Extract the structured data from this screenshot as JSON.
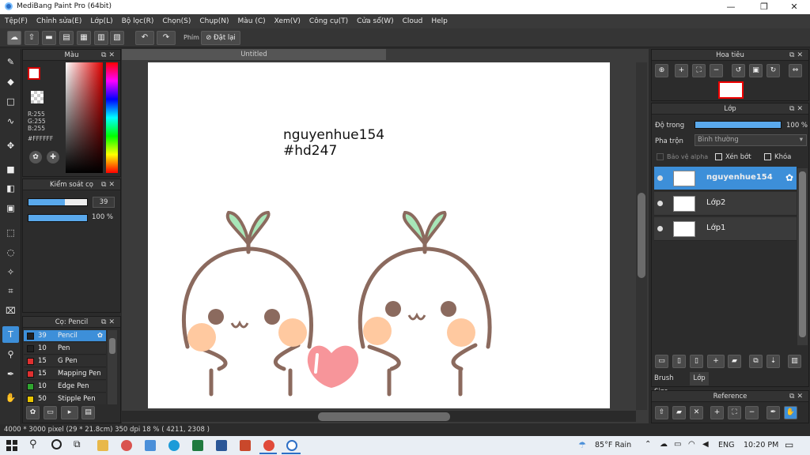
{
  "window": {
    "title": "MediBang Paint Pro (64bit)",
    "min": "—",
    "max": "❐",
    "close": "✕"
  },
  "menu": [
    "Tệp(F)",
    "Chỉnh sửa(E)",
    "Lớp(L)",
    "Bộ lọc(R)",
    "Chọn(S)",
    "Chụp(N)",
    "Màu (C)",
    "Xem(V)",
    "Công cụ(T)",
    "Cửa sổ(W)",
    "Cloud",
    "Help"
  ],
  "toolbar": {
    "key_label": "Phím",
    "reset_label": "Đặt lại"
  },
  "color_panel": {
    "title": "Màu",
    "r": "R:255",
    "g": "G:255",
    "b": "B:255",
    "hex": "#FFFFFF",
    "primary": "#ffffff",
    "secondary": "#d40000"
  },
  "brush_control": {
    "title": "Kiểm soát cọ",
    "size": "39",
    "opacity": "100 %",
    "size_fraction": 0.62,
    "opacity_fraction": 1.0
  },
  "brush_panel": {
    "title": "Cọ: Pencil",
    "items": [
      {
        "size": "39",
        "name": "Pencil",
        "color": "#222222",
        "selected": true
      },
      {
        "size": "10",
        "name": "Pen",
        "color": "#222222",
        "selected": false
      },
      {
        "size": "15",
        "name": "G Pen",
        "color": "#e03030",
        "selected": false
      },
      {
        "size": "15",
        "name": "Mapping Pen",
        "color": "#e03030",
        "selected": false
      },
      {
        "size": "10",
        "name": "Edge Pen",
        "color": "#2fa52f",
        "selected": false
      },
      {
        "size": "50",
        "name": "Stipple Pen",
        "color": "#e8c400",
        "selected": false
      }
    ]
  },
  "document": {
    "tab": "Untitled",
    "line1": "nguyenhue154",
    "line2": "#hd247"
  },
  "navigator": {
    "title": "Hoa tiêu"
  },
  "layer_panel": {
    "title": "Lớp",
    "opacity_label": "Độ trong",
    "opacity_value": "100 %",
    "opacity_fraction": 1.0,
    "blend_label": "Pha trộn",
    "blend_value": "Bình thường",
    "alpha_label": "Bảo vệ alpha",
    "clip_label": "Xén bớt",
    "lock_label": "Khóa",
    "layers": [
      {
        "name": "nguyenhue154",
        "selected": true
      },
      {
        "name": "Lớp2",
        "selected": false
      },
      {
        "name": "Lớp1",
        "selected": false
      }
    ],
    "tab_brush": "Brush Size",
    "tab_layer": "Lớp"
  },
  "reference_panel": {
    "title": "Reference"
  },
  "status": "4000 * 3000 pixel  (29 * 21.8cm)  350 dpi  18 %  ( 4211, 2308 )",
  "taskbar": {
    "weather": "85°F  Rain",
    "lang": "ENG",
    "time": "10:20 PM"
  }
}
